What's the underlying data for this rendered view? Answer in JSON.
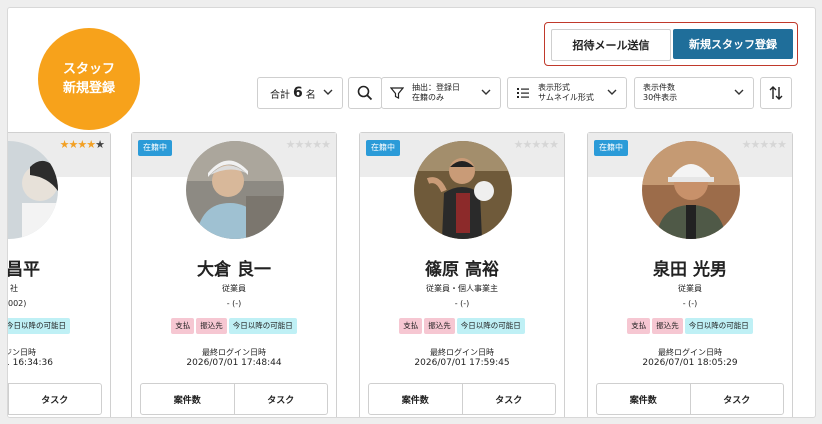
{
  "promo": {
    "line1": "スタッフ",
    "line2": "新規登録"
  },
  "actions": {
    "invite": "招待メール送信",
    "register": "新規スタッフ登録"
  },
  "toolbar": {
    "total_prefix": "合計",
    "total_count": "6",
    "total_unit": "名",
    "filter_line1": "抽出：登録日",
    "filter_line2": "在籍のみ",
    "display_line1": "表示形式",
    "display_line2": "サムネイル形式",
    "count_line1": "表示件数",
    "count_line2": "30件表示"
  },
  "cards": [
    {
      "name_fragment": "昌平",
      "role_fragment": "社",
      "dash_fragment": "002)",
      "tag": "今日以降の可能日",
      "login_label": "ジン日時",
      "login_time": "1 16:34:36",
      "footer": "タスク",
      "stars": 4
    },
    {
      "status": "在籍中",
      "name": "大倉 良一",
      "role": "従業員",
      "dash": "- (-)",
      "tags": [
        "支払",
        "振込先",
        "今日以降の可能日"
      ],
      "login_label": "最終ログイン日時",
      "login_time": "2026/07/01 17:48:44",
      "footer_left": "案件数",
      "footer_right": "タスク",
      "stars": 0
    },
    {
      "status": "在籍中",
      "name": "篠原 高裕",
      "role": "従業員・個人事業主",
      "dash": "- (-)",
      "tags": [
        "支払",
        "振込先",
        "今日以降の可能日"
      ],
      "login_label": "最終ログイン日時",
      "login_time": "2026/07/01 17:59:45",
      "footer_left": "案件数",
      "footer_right": "タスク",
      "stars": 0
    },
    {
      "status": "在籍中",
      "name": "泉田 光男",
      "role": "従業員",
      "dash": "- (-)",
      "tags": [
        "支払",
        "振込先",
        "今日以降の可能日"
      ],
      "login_label": "最終ログイン日時",
      "login_time": "2026/07/01 18:05:29",
      "footer_left": "案件数",
      "footer_right": "タスク",
      "stars": 0
    }
  ],
  "colors": {
    "accent_orange": "#f7a21b",
    "primary_blue": "#1f6e9a",
    "status_blue": "#2b9bd8"
  },
  "icons": {
    "search": "search-icon",
    "filter": "filter-icon",
    "list": "list-icon",
    "chevron": "chevron-down-icon",
    "sort": "sort-icon",
    "star": "star-icon"
  }
}
